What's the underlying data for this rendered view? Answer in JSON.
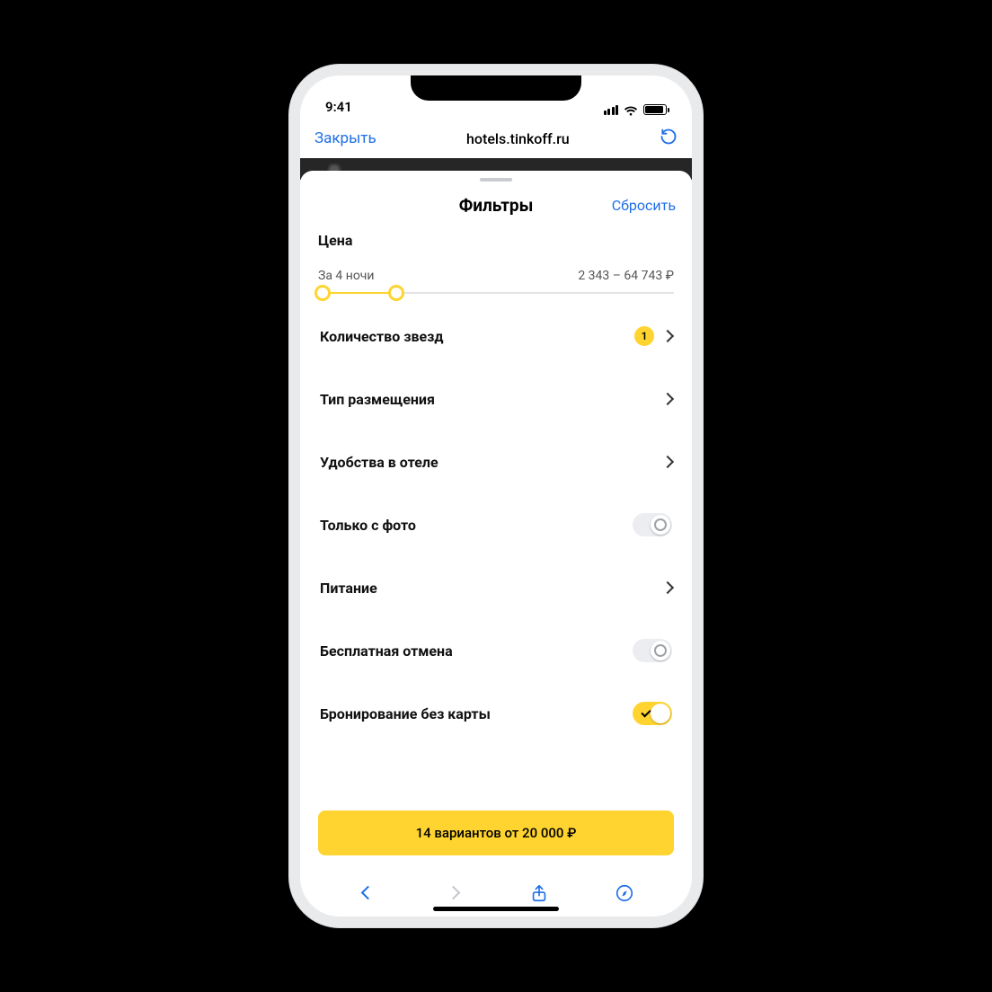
{
  "statusBar": {
    "time": "9:41"
  },
  "browser": {
    "closeLabel": "Закрыть",
    "url": "hotels.tinkoff.ru"
  },
  "sheet": {
    "title": "Фильтры",
    "resetLabel": "Сбросить",
    "price": {
      "label": "Цена",
      "nightsLabel": "За 4 ночи",
      "rangeText": "2 343 – 64 743 ₽"
    },
    "rows": {
      "stars": {
        "label": "Количество звезд",
        "badge": "1"
      },
      "type": {
        "label": "Тип размещения"
      },
      "amenities": {
        "label": "Удобства в отеле"
      },
      "photoOnly": {
        "label": "Только с фото",
        "on": false
      },
      "meals": {
        "label": "Питание"
      },
      "freeCancel": {
        "label": "Бесплатная отмена",
        "on": false
      },
      "noCard": {
        "label": "Бронирование без карты",
        "on": true
      }
    },
    "cta": "14 вариантов от 20 000 ₽"
  }
}
